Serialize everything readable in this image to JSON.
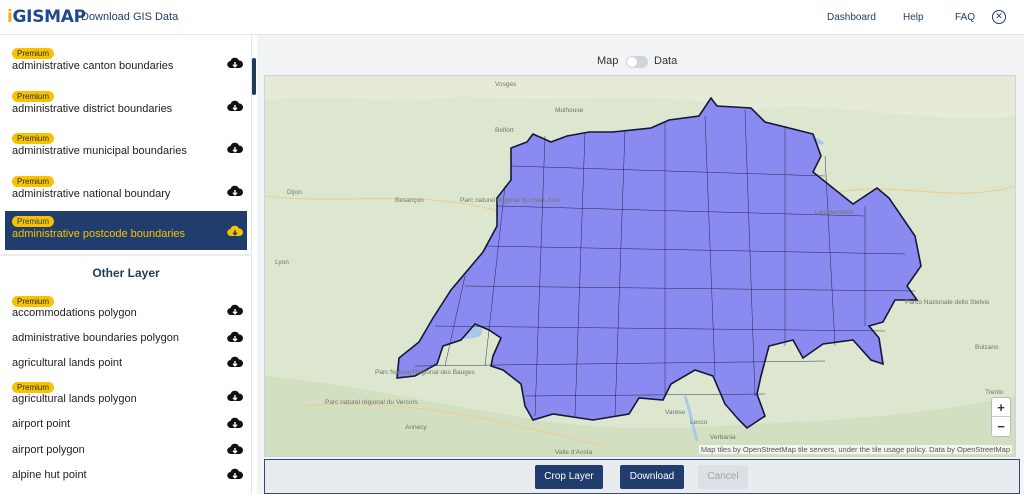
{
  "header": {
    "logo_prefix": "i",
    "logo_text": "GISMAP",
    "title": "Download GIS Data",
    "nav": [
      "Dashboard",
      "Help",
      "FAQ"
    ],
    "close_icon": "close-circle-icon"
  },
  "sidebar": {
    "premium_label": "Premium",
    "layers": [
      {
        "label": "administrative canton boundaries",
        "premium": true
      },
      {
        "label": "administrative district boundaries",
        "premium": true
      },
      {
        "label": "administrative municipal boundaries",
        "premium": true
      },
      {
        "label": "administrative national boundary",
        "premium": true
      },
      {
        "label": "administrative postcode boundaries",
        "premium": true,
        "selected": true
      }
    ],
    "other_title": "Other Layer",
    "other_layers": [
      {
        "label": "accommodations polygon",
        "premium": true
      },
      {
        "label": "administrative boundaries polygon",
        "premium": false
      },
      {
        "label": "agricultural lands point",
        "premium": false
      },
      {
        "label": "agricultural lands polygon",
        "premium": true
      },
      {
        "label": "airport point",
        "premium": false
      },
      {
        "label": "airport polygon",
        "premium": false
      },
      {
        "label": "alpine hut point",
        "premium": false
      }
    ],
    "download_icon": "cloud-download-icon"
  },
  "main": {
    "toggle": {
      "left": "Map",
      "right": "Data",
      "value": "Map"
    },
    "map_labels": [
      "Vosges",
      "Mulhouse",
      "Belfort",
      "Dijon",
      "Besançon",
      "Parc naturel régional du Haut-Jura",
      "Lyon",
      "Annecy",
      "Parc naturel régional du Vercors",
      "Lecco",
      "Verbania",
      "Varese",
      "Parc Naturel Régional des Bauges",
      "Valle d'Aosta",
      "Parco Nazionale dello Stelvio",
      "Trento",
      "Bolzano",
      "Liechtenstein"
    ],
    "attribution": "Map tiles by OpenStreetMap tile servers, under the tile usage policy. Data by OpenStreetMap",
    "zoom_in": "+",
    "zoom_out": "−",
    "buttons": {
      "crop": "Crop Layer",
      "download": "Download",
      "cancel": "Cancel"
    },
    "colors": {
      "primary": "#213d6e",
      "accent": "#f7c300",
      "boundary_fill": "#8a8af0"
    }
  }
}
